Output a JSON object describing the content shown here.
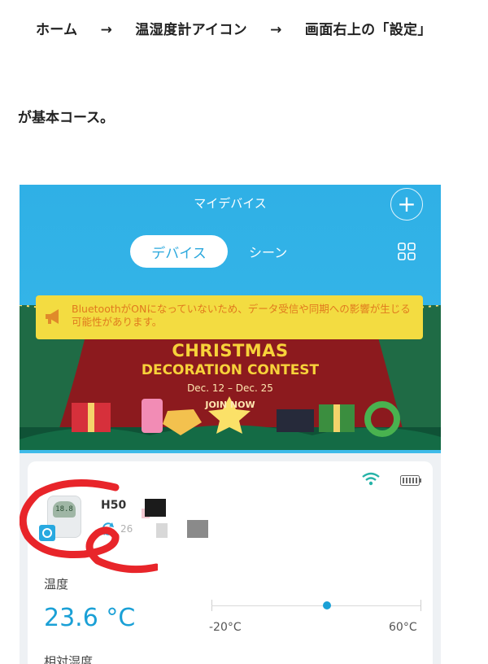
{
  "instructions": {
    "path": [
      "ホーム",
      "→",
      "温湿度計アイコン",
      "→",
      "画面右上の「設定」"
    ],
    "line2": "が基本コース。"
  },
  "app": {
    "title": "マイデバイス",
    "add_icon": "plus-icon",
    "tabs": {
      "device": "デバイス",
      "scene": "シーン"
    },
    "grid_icon": "grid-icon",
    "bluetooth_warning": "Bluetoothが​ONになっていないため、データ受信や同期への影響が生じる可能性があります。",
    "banner": {
      "title": "CHRISTMAS",
      "subtitle": "DECORATION CONTEST",
      "date": "Dec. 12 – Dec. 25",
      "cta": "JOIN NOW"
    },
    "device_card": {
      "name": "H50",
      "sync_text": "26",
      "thumb_text": "18.8",
      "temperature_label": "温度",
      "temperature_value": "23.6 °C",
      "temperature_level": 0.55,
      "range_min": "-20°C",
      "range_max": "60°C",
      "humidity_label": "相対湿度"
    }
  },
  "colors": {
    "accent": "#1aa0d6",
    "header": "#35b5e8",
    "warning_bg": "#f3dc41",
    "warning_text": "#e07a1e",
    "annotation": "#e8252a"
  }
}
